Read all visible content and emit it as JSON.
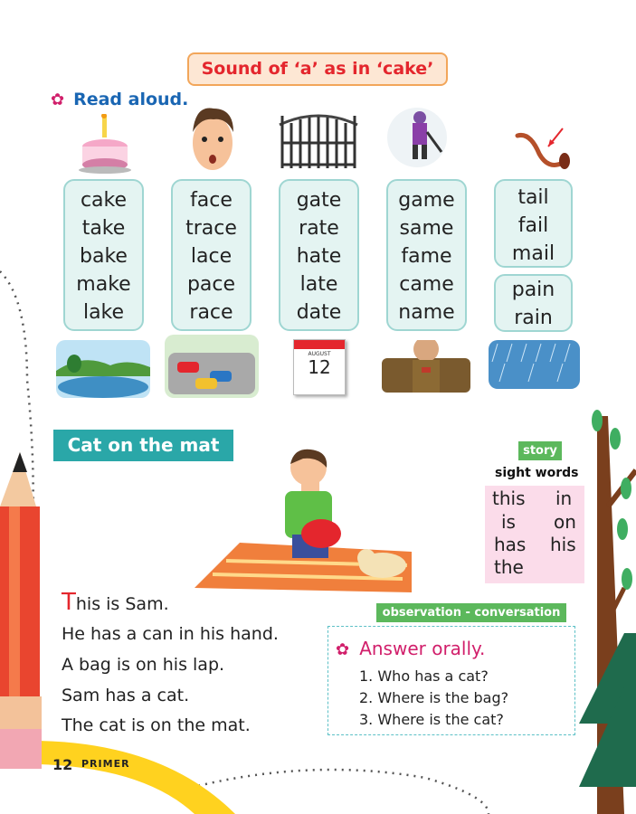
{
  "title": "Sound of ‘a’ as in ‘cake’",
  "read_aloud": {
    "icon": "flower-icon",
    "label": "Read aloud."
  },
  "word_groups": [
    [
      "cake",
      "take",
      "bake",
      "make",
      "lake"
    ],
    [
      "face",
      "trace",
      "lace",
      "pace",
      "race"
    ],
    [
      "gate",
      "rate",
      "hate",
      "late",
      "date"
    ],
    [
      "game",
      "same",
      "fame",
      "came",
      "name"
    ],
    [
      "tail",
      "fail",
      "mail"
    ],
    [
      "pain",
      "rain"
    ]
  ],
  "calendar": {
    "month": "AUGUST",
    "day": "12"
  },
  "section": {
    "title": "Cat on the mat",
    "story_tag": "story",
    "sight_heading": "sight words",
    "sight_words": [
      "this",
      "in",
      "is",
      "on",
      "has",
      "his",
      "the"
    ],
    "story_first_letter": "T",
    "story_first_rest": "his is Sam.",
    "story_lines": [
      "He has a can in his hand.",
      "A bag is on his lap.",
      "Sam has a cat.",
      "The cat is on the mat."
    ],
    "conv_tag": "observation - conversation",
    "answer_heading": "Answer orally.",
    "questions": [
      "1. Who has a cat?",
      "2. Where is the bag?",
      "3. Where is the cat?"
    ]
  },
  "footer": {
    "page_number": "12",
    "label": "PRIMER"
  },
  "colors": {
    "title_red": "#e4262d",
    "teal": "#2aa7a8",
    "green_tag": "#5cb85c",
    "pink": "#d11f6b"
  }
}
